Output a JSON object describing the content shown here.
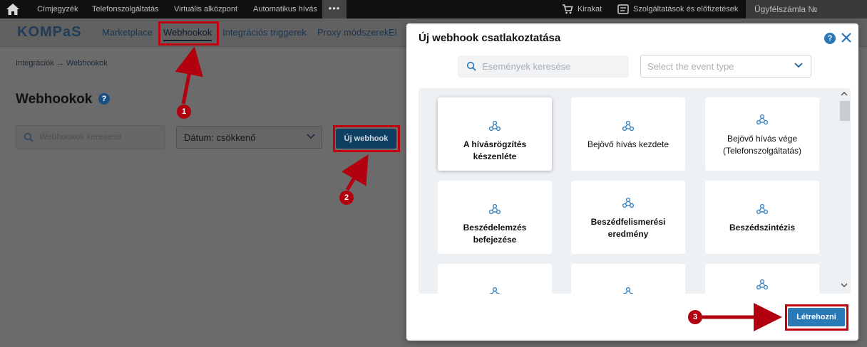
{
  "topbar": {
    "nav": [
      "Címjegyzék",
      "Telefonszolgáltatás",
      "Virtuális alközpont",
      "Automatikus hívás"
    ],
    "more": "•••",
    "shop": "Kirakat",
    "services": "Szolgáltatások és előfizetések",
    "account": "Ügyfélszámla №"
  },
  "appbar": {
    "logo": "KOMPaS",
    "nav": [
      "Marketplace",
      "Webhookok",
      "Integrációs triggerek",
      "Proxy módszerek",
      "El"
    ]
  },
  "breadcrumb": {
    "root": "Integrációk",
    "separator": "→",
    "current": "Webhookok"
  },
  "page": {
    "title": "Webhookok",
    "help": "?",
    "search_placeholder": "Webhookok keresése",
    "sort_value": "Dátum: csökkenő",
    "new_button": "Új webhook"
  },
  "modal": {
    "title": "Új webhook csatlakoztatása",
    "help": "?",
    "search_placeholder": "Események keresése",
    "event_type_placeholder": "Select the event type",
    "cards": [
      "A hívásrögzítés készenléte",
      "Bejövő hívás kezdete",
      "Bejövő hívás vége (Telefonszolgáltatás)",
      "Beszédelemzés befejezése",
      "Beszédfelismerési eredmény",
      "Beszédszintézis"
    ],
    "create_button": "Létrehozni"
  },
  "annotations": [
    "1",
    "2",
    "3"
  ],
  "colors": {
    "accent": "#2a7ab8",
    "annotation_red": "#c00010",
    "topbar": "#111111"
  }
}
